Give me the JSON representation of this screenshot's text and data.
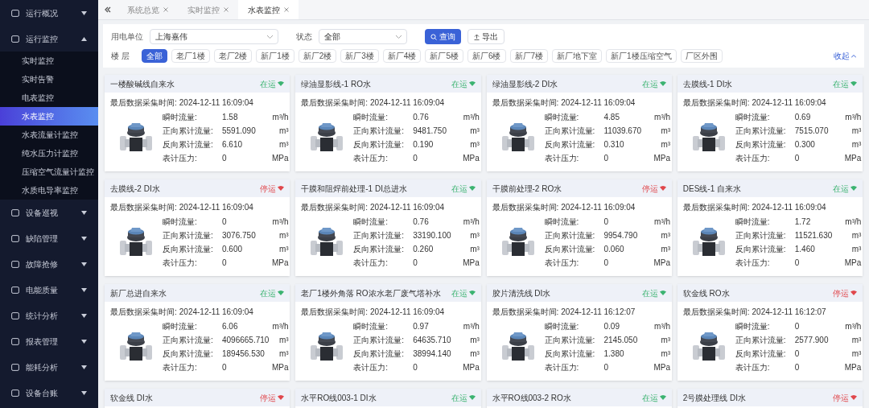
{
  "sidebar": {
    "items": [
      {
        "label": "运行概况",
        "expanded": false
      },
      {
        "label": "运行监控",
        "expanded": true,
        "children": [
          {
            "label": "实时监控",
            "selected": false
          },
          {
            "label": "实时告警",
            "selected": false
          },
          {
            "label": "电表监控",
            "selected": false
          },
          {
            "label": "水表监控",
            "selected": true
          },
          {
            "label": "水表流量计监控",
            "selected": false
          },
          {
            "label": "纯水压力计监控",
            "selected": false
          },
          {
            "label": "压缩空气流量计监控",
            "selected": false
          },
          {
            "label": "水质电导率监控",
            "selected": false
          }
        ]
      },
      {
        "label": "设备巡视",
        "expanded": false
      },
      {
        "label": "缺陷管理",
        "expanded": false
      },
      {
        "label": "故障抢修",
        "expanded": false
      },
      {
        "label": "电能质量",
        "expanded": false
      },
      {
        "label": "统计分析",
        "expanded": false
      },
      {
        "label": "报表管理",
        "expanded": false
      },
      {
        "label": "能耗分析",
        "expanded": false
      },
      {
        "label": "设备台账",
        "expanded": false
      }
    ]
  },
  "tabs": [
    {
      "label": "系统总览",
      "selected": false
    },
    {
      "label": "实时监控",
      "selected": false
    },
    {
      "label": "水表监控",
      "selected": true
    }
  ],
  "filters": {
    "unit_label": "用电单位",
    "unit_value": "上海嘉伟",
    "status_label": "状态",
    "status_value": "全部",
    "query_button": "查询",
    "export_button": "导出",
    "floor_label": "楼 层",
    "collapse_link": "收起",
    "floors": [
      {
        "label": "全部",
        "selected": true
      },
      {
        "label": "老厂1楼",
        "selected": false
      },
      {
        "label": "老厂2楼",
        "selected": false
      },
      {
        "label": "新厂1楼",
        "selected": false
      },
      {
        "label": "新厂2楼",
        "selected": false
      },
      {
        "label": "新厂3楼",
        "selected": false
      },
      {
        "label": "新厂4楼",
        "selected": false
      },
      {
        "label": "新厂5楼",
        "selected": false
      },
      {
        "label": "新厂6楼",
        "selected": false
      },
      {
        "label": "新厂7楼",
        "selected": false
      },
      {
        "label": "新厂地下室",
        "selected": false
      },
      {
        "label": "新厂1楼压缩空气",
        "selected": false
      },
      {
        "label": "厂区外围",
        "selected": false
      }
    ]
  },
  "cards": [
    {
      "title": "一楼酸碱线自来水",
      "status": "在运",
      "online": true,
      "time_label": "最后数据采集时间:",
      "time": "2024-12-11 16:09:04",
      "readings": [
        {
          "label": "瞬时流量:",
          "value": "1.58",
          "unit": "m³/h"
        },
        {
          "label": "正向累计流量:",
          "value": "5591.090",
          "unit": "m³"
        },
        {
          "label": "反向累计流量:",
          "value": "6.610",
          "unit": "m³"
        },
        {
          "label": "表计压力:",
          "value": "0",
          "unit": "MPa"
        }
      ]
    },
    {
      "title": "绿油显影线-1 RO水",
      "status": "在运",
      "online": true,
      "time_label": "最后数据采集时间:",
      "time": "2024-12-11 16:09:04",
      "readings": [
        {
          "label": "瞬时流量:",
          "value": "0.76",
          "unit": "m³/h"
        },
        {
          "label": "正向累计流量:",
          "value": "9481.750",
          "unit": "m³"
        },
        {
          "label": "反向累计流量:",
          "value": "0.190",
          "unit": "m³"
        },
        {
          "label": "表计压力:",
          "value": "0",
          "unit": "MPa"
        }
      ]
    },
    {
      "title": "绿油显影线-2 DI水",
      "status": "在运",
      "online": true,
      "time_label": "最后数据采集时间:",
      "time": "2024-12-11 16:09:04",
      "readings": [
        {
          "label": "瞬时流量:",
          "value": "4.85",
          "unit": "m³/h"
        },
        {
          "label": "正向累计流量:",
          "value": "11039.670",
          "unit": "m³"
        },
        {
          "label": "反向累计流量:",
          "value": "0.310",
          "unit": "m³"
        },
        {
          "label": "表计压力:",
          "value": "0",
          "unit": "MPa"
        }
      ]
    },
    {
      "title": "去膜线-1 DI水",
      "status": "在运",
      "online": true,
      "time_label": "最后数据采集时间:",
      "time": "2024-12-11 16:09:04",
      "readings": [
        {
          "label": "瞬时流量:",
          "value": "0.69",
          "unit": "m³/h"
        },
        {
          "label": "正向累计流量:",
          "value": "7515.070",
          "unit": "m³"
        },
        {
          "label": "反向累计流量:",
          "value": "0.300",
          "unit": "m³"
        },
        {
          "label": "表计压力:",
          "value": "0",
          "unit": "MPa"
        }
      ]
    },
    {
      "title": "去膜线-2 DI水",
      "status": "停运",
      "online": false,
      "time_label": "最后数据采集时间:",
      "time": "2024-12-11 16:09:04",
      "readings": [
        {
          "label": "瞬时流量:",
          "value": "0",
          "unit": "m³/h"
        },
        {
          "label": "正向累计流量:",
          "value": "3076.750",
          "unit": "m³"
        },
        {
          "label": "反向累计流量:",
          "value": "0.600",
          "unit": "m³"
        },
        {
          "label": "表计压力:",
          "value": "0",
          "unit": "MPa"
        }
      ]
    },
    {
      "title": "干膜和阻焊前处理-1 DI总进水",
      "status": "在运",
      "online": true,
      "time_label": "最后数据采集时间:",
      "time": "2024-12-11 16:09:04",
      "readings": [
        {
          "label": "瞬时流量:",
          "value": "0.76",
          "unit": "m³/h"
        },
        {
          "label": "正向累计流量:",
          "value": "33190.100",
          "unit": "m³"
        },
        {
          "label": "反向累计流量:",
          "value": "0.260",
          "unit": "m³"
        },
        {
          "label": "表计压力:",
          "value": "0",
          "unit": "MPa"
        }
      ]
    },
    {
      "title": "干膜前处理-2 RO水",
      "status": "停运",
      "online": false,
      "time_label": "最后数据采集时间:",
      "time": "2024-12-11 16:09:04",
      "readings": [
        {
          "label": "瞬时流量:",
          "value": "0",
          "unit": "m³/h"
        },
        {
          "label": "正向累计流量:",
          "value": "9954.790",
          "unit": "m³"
        },
        {
          "label": "反向累计流量:",
          "value": "0.060",
          "unit": "m³"
        },
        {
          "label": "表计压力:",
          "value": "0",
          "unit": "MPa"
        }
      ]
    },
    {
      "title": "DES线-1 自来水",
      "status": "在运",
      "online": true,
      "time_label": "最后数据采集时间:",
      "time": "2024-12-11 16:09:04",
      "readings": [
        {
          "label": "瞬时流量:",
          "value": "1.72",
          "unit": "m³/h"
        },
        {
          "label": "正向累计流量:",
          "value": "11521.630",
          "unit": "m³"
        },
        {
          "label": "反向累计流量:",
          "value": "1.460",
          "unit": "m³"
        },
        {
          "label": "表计压力:",
          "value": "0",
          "unit": "MPa"
        }
      ]
    },
    {
      "title": "新厂总进自来水",
      "status": "在运",
      "online": true,
      "time_label": "最后数据采集时间:",
      "time": "2024-12-11 16:09:04",
      "readings": [
        {
          "label": "瞬时流量:",
          "value": "6.06",
          "unit": "m³/h"
        },
        {
          "label": "正向累计流量:",
          "value": "4096665.710",
          "unit": "m³"
        },
        {
          "label": "反向累计流量:",
          "value": "189456.530",
          "unit": "m³"
        },
        {
          "label": "表计压力:",
          "value": "0",
          "unit": "MPa"
        }
      ]
    },
    {
      "title": "老厂1楼外角落 RO浓水老厂废气塔补水",
      "status": "在运",
      "online": true,
      "time_label": "最后数据采集时间:",
      "time": "2024-12-11 16:09:04",
      "readings": [
        {
          "label": "瞬时流量:",
          "value": "0.97",
          "unit": "m³/h"
        },
        {
          "label": "正向累计流量:",
          "value": "64635.710",
          "unit": "m³"
        },
        {
          "label": "反向累计流量:",
          "value": "38994.140",
          "unit": "m³"
        },
        {
          "label": "表计压力:",
          "value": "0",
          "unit": "MPa"
        }
      ]
    },
    {
      "title": "胶片清洗线 DI水",
      "status": "在运",
      "online": true,
      "time_label": "最后数据采集时间:",
      "time": "2024-12-11 16:12:07",
      "readings": [
        {
          "label": "瞬时流量:",
          "value": "0.09",
          "unit": "m³/h"
        },
        {
          "label": "正向累计流量:",
          "value": "2145.050",
          "unit": "m³"
        },
        {
          "label": "反向累计流量:",
          "value": "1.380",
          "unit": "m³"
        },
        {
          "label": "表计压力:",
          "value": "0",
          "unit": "MPa"
        }
      ]
    },
    {
      "title": "软金线 RO水",
      "status": "停运",
      "online": false,
      "time_label": "最后数据采集时间:",
      "time": "2024-12-11 16:12:07",
      "readings": [
        {
          "label": "瞬时流量:",
          "value": "0",
          "unit": "m³/h"
        },
        {
          "label": "正向累计流量:",
          "value": "2577.900",
          "unit": "m³"
        },
        {
          "label": "反向累计流量:",
          "value": "0",
          "unit": "m³"
        },
        {
          "label": "表计压力:",
          "value": "0",
          "unit": "MPa"
        }
      ]
    },
    {
      "title": "软金线 DI水",
      "status": "停运",
      "online": false
    },
    {
      "title": "水平RO线003-1 DI水",
      "status": "在运",
      "online": true
    },
    {
      "title": "水平RO线003-2 RO水",
      "status": "在运",
      "online": true
    },
    {
      "title": "2号膜处理线 DI水",
      "status": "停运",
      "online": false
    }
  ]
}
